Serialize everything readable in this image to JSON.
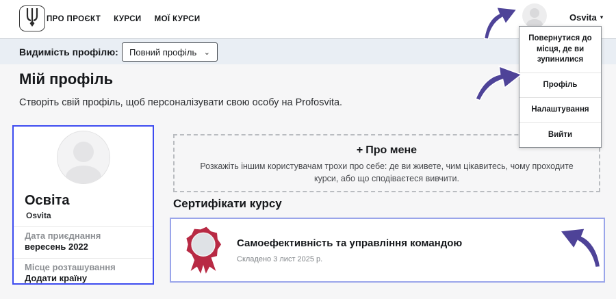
{
  "header": {
    "logo_icon": "tryzub-icon",
    "nav": [
      {
        "label": "ПРО ПРОЄКТ"
      },
      {
        "label": "КУРСИ"
      },
      {
        "label": "МОЇ КУРСИ"
      }
    ],
    "user": {
      "name": "Osvita",
      "caret": "▾"
    }
  },
  "user_menu": {
    "items": [
      {
        "label": "Повернутися до місця, де ви зупинилися"
      },
      {
        "label": "Профіль"
      },
      {
        "label": "Налаштування"
      },
      {
        "label": "Вийти"
      }
    ]
  },
  "visibility_bar": {
    "label": "Видимість профілю:",
    "selected_option": "Повний профіль",
    "chevron": "⌄"
  },
  "page": {
    "title": "Мій профіль",
    "subtitle": "Створіть свій профіль, щоб персоналізувати свою особу на Profosvita."
  },
  "profile_card": {
    "name": "Освіта",
    "username": "Osvita",
    "joined_label": "Дата приєднання",
    "joined_value": "вересень 2022",
    "location_label": "Місце розташування",
    "location_value": "Додати країну"
  },
  "about": {
    "plus": "+",
    "title": "Про мене",
    "description": "Розкажіть іншим користувачам трохи про себе: де ви живете, чим цікавитесь, чому проходите курси, або що сподіваєтеся вивчити."
  },
  "certificates": {
    "heading": "Сертифікати курсу",
    "items": [
      {
        "title": "Самоефективність та управління командою",
        "completed": "Складено 3 лист 2025 р."
      }
    ]
  },
  "colors": {
    "profile_card_border": "#3d4bf0",
    "certificate_card_border": "#9aa5ea",
    "annotation_arrow": "#4e4398",
    "medal_red": "#b82a44",
    "visibility_bar_bg": "#e9eef4"
  }
}
